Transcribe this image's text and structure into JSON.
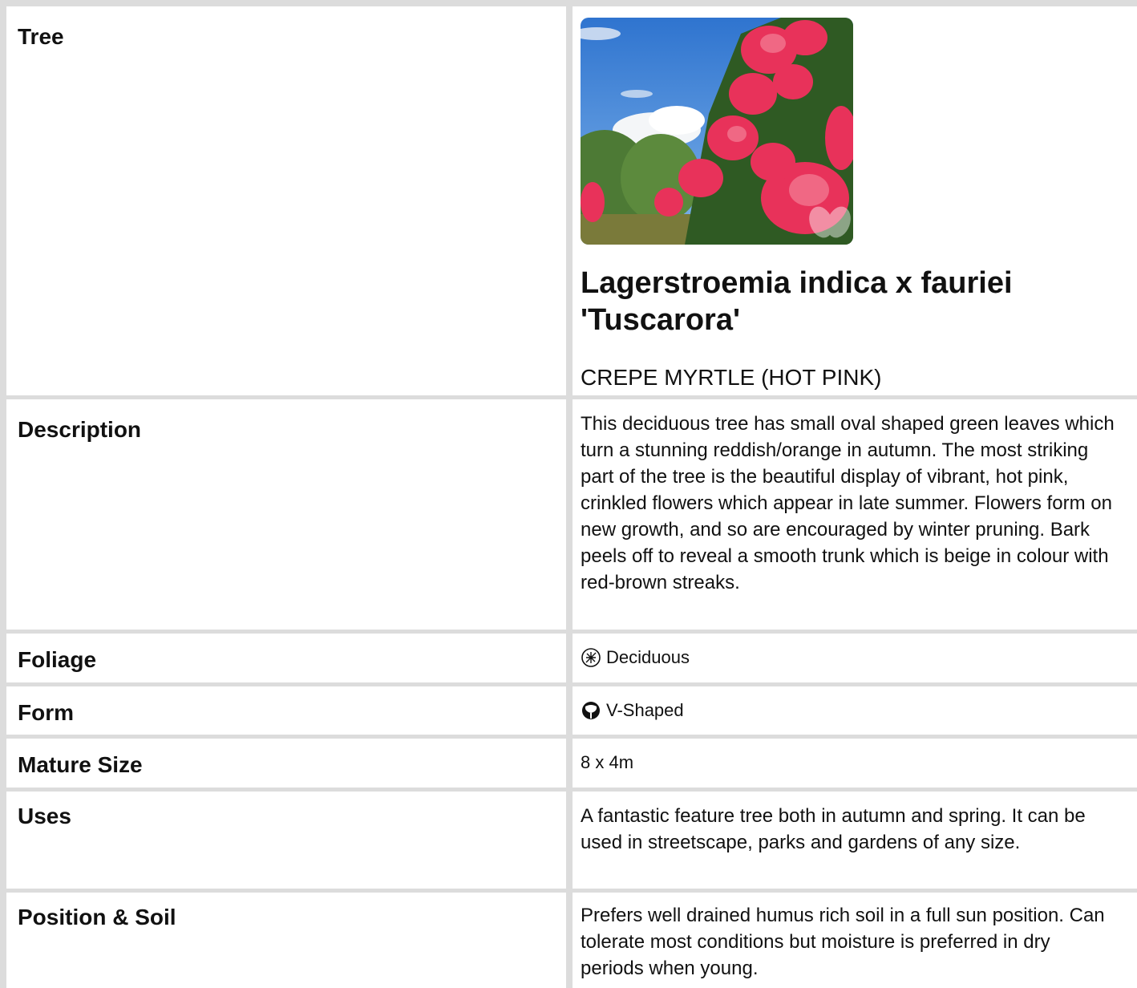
{
  "rows": {
    "tree": {
      "label": "Tree"
    },
    "description": {
      "label": "Description",
      "value": "This deciduous tree has small oval shaped green leaves which turn a stunning reddish/orange in autumn. The most striking part of the tree is the beautiful display of vibrant, hot pink, crinkled flowers which appear in late summer. Flowers form on new growth, and so are encouraged by winter pruning. Bark peels off to reveal a smooth trunk which is beige in colour with red-brown streaks."
    },
    "foliage": {
      "label": "Foliage",
      "value": "Deciduous",
      "icon": "deciduous-icon"
    },
    "form": {
      "label": "Form",
      "value": "V-Shaped",
      "icon": "v-shaped-tree-icon"
    },
    "mature_size": {
      "label": "Mature Size",
      "value": "8 x 4m"
    },
    "uses": {
      "label": "Uses",
      "value": "A fantastic feature tree both in autumn and spring. It can be used in streetscape, parks and gardens of any size."
    },
    "position_soil": {
      "label": "Position & Soil",
      "value": "Prefers well drained humus rich soil in a full sun position. Can tolerate most conditions but moisture is preferred in dry periods when young."
    }
  },
  "plant": {
    "botanical_name": "Lagerstroemia indica x fauriei 'Tuscarora'",
    "common_name": "CREPE MYRTLE (HOT PINK)"
  },
  "colors": {
    "border": "#dcdcdc",
    "flower_pink": "#e8325a",
    "sky": "#3f86d8",
    "foliage_green": "#3f6b2c"
  }
}
